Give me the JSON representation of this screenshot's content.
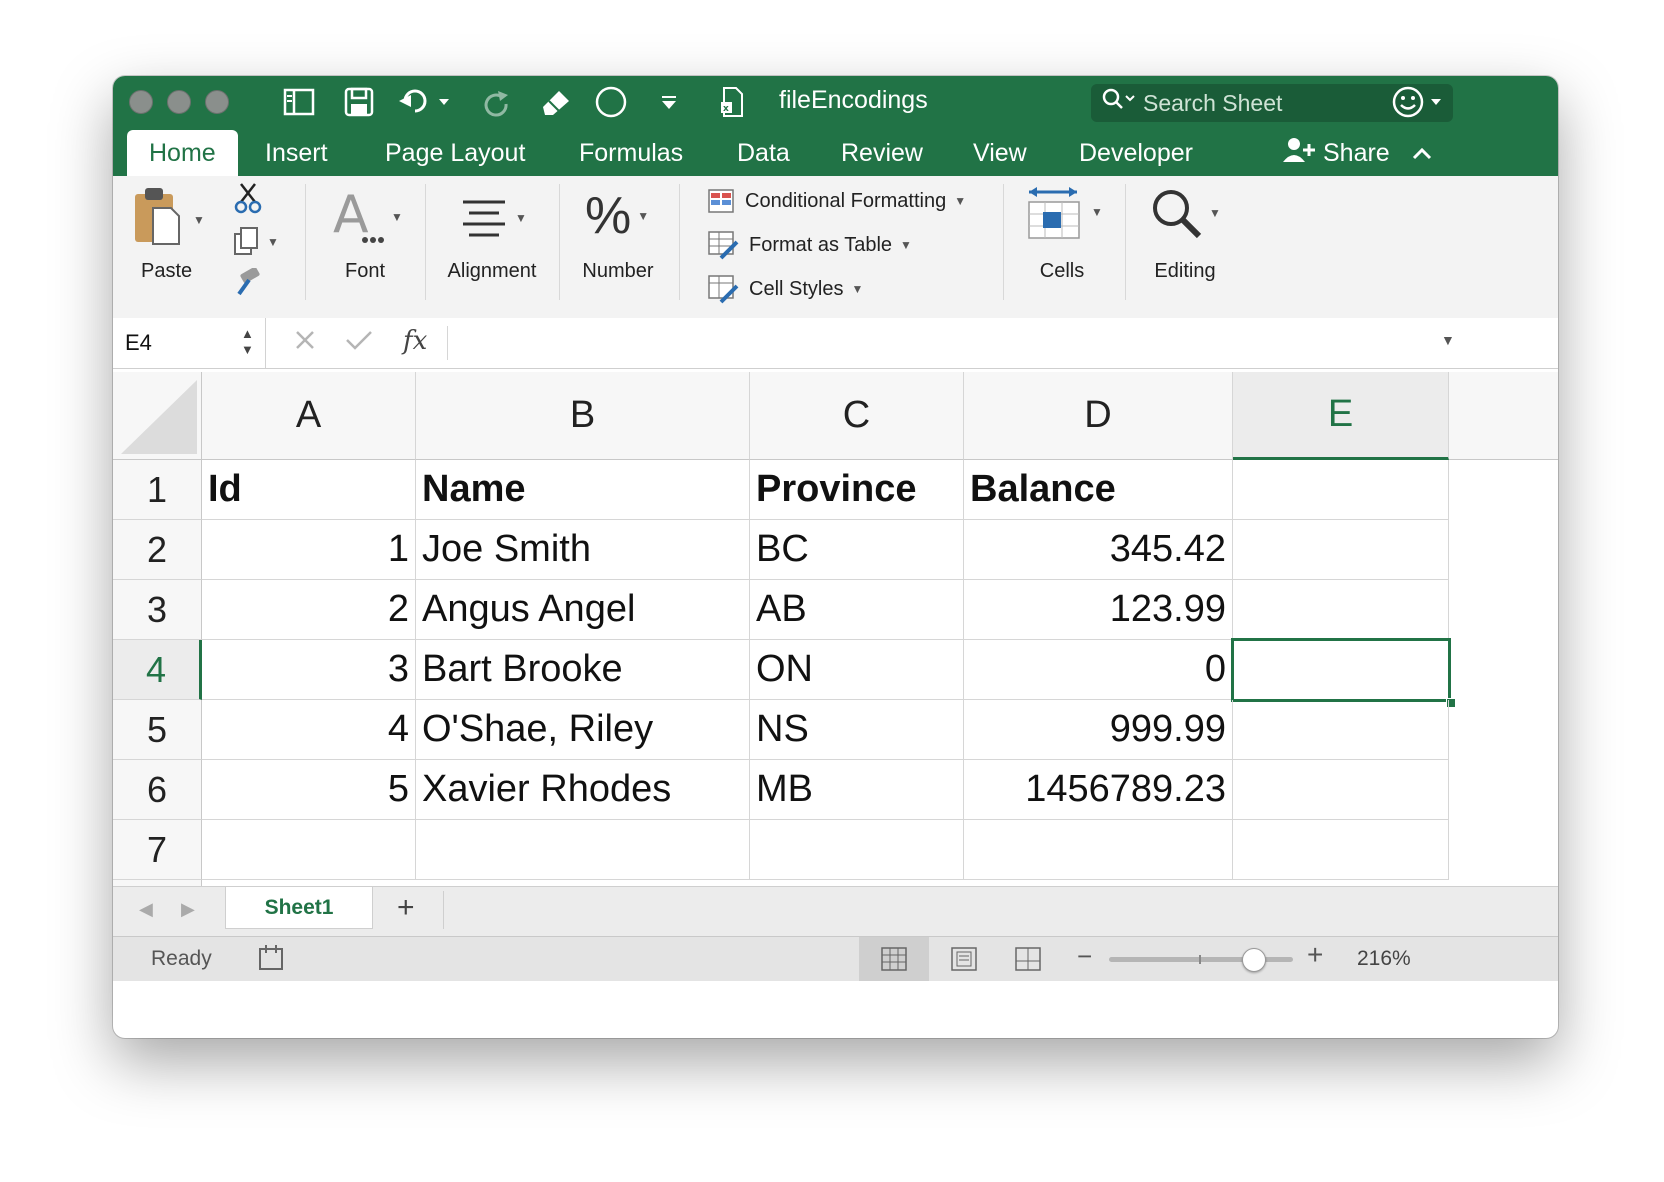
{
  "window": {
    "title": "fileEncodings",
    "search_placeholder": "Search Sheet",
    "accent_color": "#217346"
  },
  "tabs": [
    {
      "label": "Home",
      "active": true
    },
    {
      "label": "Insert"
    },
    {
      "label": "Page Layout"
    },
    {
      "label": "Formulas"
    },
    {
      "label": "Data"
    },
    {
      "label": "Review"
    },
    {
      "label": "View"
    },
    {
      "label": "Developer"
    }
  ],
  "share_label": "Share",
  "ribbon": {
    "paste": "Paste",
    "font": "Font",
    "alignment": "Alignment",
    "number": "Number",
    "conditional_formatting": "Conditional Formatting",
    "format_as_table": "Format as Table",
    "cell_styles": "Cell Styles",
    "cells": "Cells",
    "editing": "Editing",
    "number_icon": "%"
  },
  "formula_bar": {
    "name_box": "E4",
    "fx": "fx",
    "value": ""
  },
  "columns": [
    "A",
    "B",
    "C",
    "D",
    "E"
  ],
  "selected_column": "E",
  "rows": [
    "1",
    "2",
    "3",
    "4",
    "5",
    "6",
    "7"
  ],
  "selected_row": "4",
  "cells": [
    [
      "Id",
      "Name",
      "Province",
      "Balance",
      ""
    ],
    [
      "1",
      "Joe Smith",
      "BC",
      "345.42",
      ""
    ],
    [
      "2",
      "Angus Angel",
      "AB",
      "123.99",
      ""
    ],
    [
      "3",
      "Bart Brooke",
      "ON",
      "0",
      ""
    ],
    [
      "4",
      "O'Shae, Riley",
      "NS",
      "999.99",
      ""
    ],
    [
      "5",
      "Xavier Rhodes",
      "MB",
      "1456789.23",
      ""
    ],
    [
      "",
      "",
      "",
      "",
      ""
    ]
  ],
  "sheets": [
    {
      "label": "Sheet1",
      "active": true
    }
  ],
  "status": {
    "ready": "Ready",
    "zoom": "216%",
    "zoom_level": 0.78
  }
}
